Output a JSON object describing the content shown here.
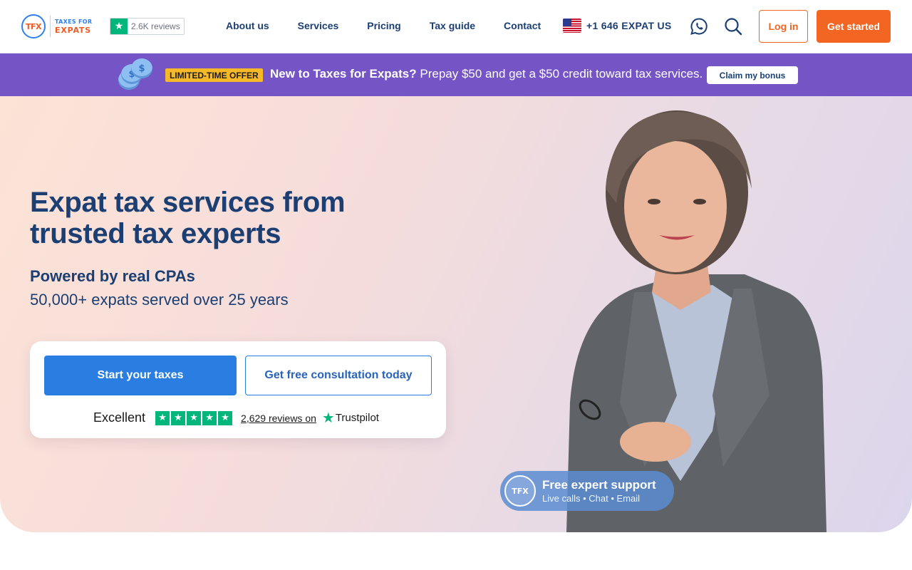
{
  "header": {
    "logo_mark": "TFX",
    "logo_line1": "TAXES FOR",
    "logo_line2": "EXPATS",
    "trustpilot_reviews": "2.6K reviews",
    "nav": [
      "About us",
      "Services",
      "Pricing",
      "Tax guide",
      "Contact"
    ],
    "phone": "+1 646 EXPAT US",
    "login_label": "Log in",
    "get_started_label": "Get started"
  },
  "promo": {
    "badge": "LIMITED-TIME OFFER",
    "headline": "New to Taxes for Expats?",
    "text": " Prepay $50 and get a $50 credit toward tax services.",
    "button": "Claim my bonus"
  },
  "hero": {
    "title": "Expat tax services from trusted tax experts",
    "subtitle_bold": "Powered by real CPAs",
    "subtitle": "50,000+ expats served over 25 years",
    "cta_primary": "Start your taxes",
    "cta_secondary": "Get free consultation today",
    "rating_word": "Excellent",
    "rating_stars": 5,
    "review_count": "2,629 reviews on",
    "review_source": "Trustpilot"
  },
  "support_badge": {
    "mark": "TFX",
    "title": "Free expert support",
    "channels": "Live calls • Chat • Email"
  },
  "colors": {
    "brand_orange": "#f26522",
    "brand_blue": "#2a7de1",
    "navy": "#1b3f73",
    "promo_purple": "#7554c5",
    "trustpilot_green": "#00b67a"
  }
}
